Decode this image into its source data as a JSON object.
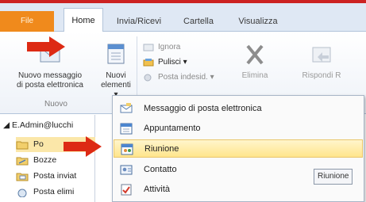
{
  "colors": {
    "file_tab": "#f08a1c",
    "highlight": "#ffe58c",
    "arrow": "#dd2a14",
    "selected_folder": "#fbe7a9"
  },
  "tabs": {
    "file": "File",
    "home": "Home",
    "send_receive": "Invia/Ricevi",
    "folder": "Cartella",
    "view": "Visualizza"
  },
  "ribbon": {
    "new_mail_line1": "Nuovo messaggio",
    "new_mail_line2": "di posta elettronica",
    "new_items_line1": "Nuovi",
    "new_items_line2": "elementi ▾",
    "ignore": "Ignora",
    "cleanup": "Pulisci ▾",
    "junk": "Posta indesid. ▾",
    "delete": "Elimina",
    "reply": "Rispondi",
    "reply_cut": "R",
    "group_new": "Nuovo"
  },
  "nav": {
    "account": "◢ E.Admin@lucchi",
    "folders": [
      {
        "name": "Po",
        "icon": "inbox-folder-icon"
      },
      {
        "name": "Bozze",
        "icon": "drafts-folder-icon"
      },
      {
        "name": "Posta inviat",
        "icon": "sent-folder-icon"
      },
      {
        "name": "Posta elimi",
        "icon": "deleted-folder-icon"
      }
    ]
  },
  "menu": {
    "items": [
      {
        "label": "Messaggio di posta elettronica",
        "icon": "mail-message-icon"
      },
      {
        "label": "Appuntamento",
        "icon": "appointment-icon"
      },
      {
        "label": "Riunione",
        "icon": "meeting-icon"
      },
      {
        "label": "Contatto",
        "icon": "contact-icon"
      },
      {
        "label": "Attività",
        "icon": "task-icon"
      }
    ],
    "highlighted_index": 2
  },
  "tooltip": {
    "text": "Riunione"
  }
}
